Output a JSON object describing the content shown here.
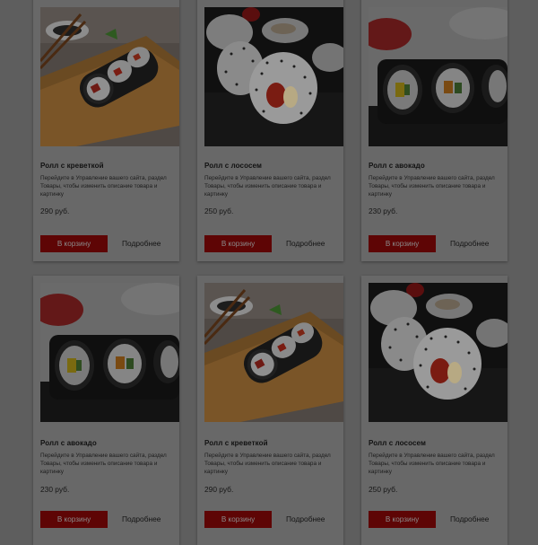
{
  "products": [
    {
      "title": "Ролл с креветкой",
      "description": "Перейдите в Управление вашего сайта, раздел Товары, чтобы изменить описание товара и картинку",
      "price": "290 руб.",
      "cart_label": "В корзину",
      "more_label": "Подробнее",
      "image": "shrimp-roll-photo"
    },
    {
      "title": "Ролл с лососем",
      "description": "Перейдите в Управление вашего сайта, раздел Товары, чтобы изменить описание товара и картинку",
      "price": "250 руб.",
      "cart_label": "В корзину",
      "more_label": "Подробнее",
      "image": "salmon-roll-photo"
    },
    {
      "title": "Ролл с авокадо",
      "description": "Перейдите в Управление вашего сайта, раздел Товары, чтобы изменить описание товара и картинку",
      "price": "230 руб.",
      "cart_label": "В корзину",
      "more_label": "Подробнее",
      "image": "avocado-roll-photo"
    },
    {
      "title": "Ролл с авокадо",
      "description": "Перейдите в Управление вашего сайта, раздел Товары, чтобы изменить описание товара и картинку",
      "price": "230 руб.",
      "cart_label": "В корзину",
      "more_label": "Подробнее",
      "image": "avocado-roll-photo"
    },
    {
      "title": "Ролл с креветкой",
      "description": "Перейдите в Управление вашего сайта, раздел Товары, чтобы изменить описание товара и картинку",
      "price": "290 руб.",
      "cart_label": "В корзину",
      "more_label": "Подробнее",
      "image": "shrimp-roll-photo"
    },
    {
      "title": "Ролл с лососем",
      "description": "Перейдите в Управление вашего сайта, раздел Товары, чтобы изменить описание товара и картинку",
      "price": "250 руб.",
      "cart_label": "В корзину",
      "more_label": "Подробнее",
      "image": "salmon-roll-photo"
    }
  ],
  "colors": {
    "page_background": "#5e5e5e",
    "card_background": "#686868",
    "button_background": "#5e0505",
    "button_text": "#8a8a8a",
    "overlay": "dim-modal-backdrop"
  }
}
